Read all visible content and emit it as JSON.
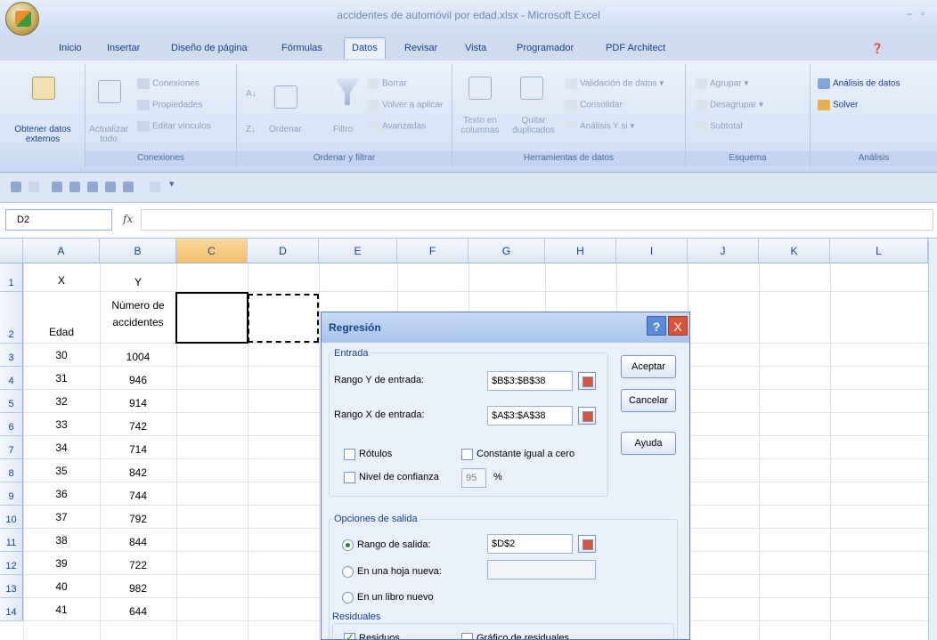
{
  "window": {
    "title": "accidentes de automóvil por edad.xlsx - Microsoft Excel"
  },
  "tabs": [
    "Inicio",
    "Insertar",
    "Diseño de página",
    "Fórmulas",
    "Datos",
    "Revisar",
    "Vista",
    "Programador",
    "PDF Architect"
  ],
  "ribbon": {
    "get_external": "Obtener datos externos",
    "refresh": "Actualizar todo",
    "connections": "Conexiones",
    "properties": "Propiedades",
    "edit_links": "Editar vínculos",
    "group_connections": "Conexiones",
    "sort": "Ordenar",
    "filter": "Filtro",
    "clear": "Borrar",
    "reapply": "Volver a aplicar",
    "advanced": "Avanzadas",
    "group_sort_filter": "Ordenar y filtrar",
    "text_to_columns": "Texto en columnas",
    "remove_duplicates": "Quitar duplicados",
    "data_validation": "Validación de datos",
    "consolidate": "Consolidar",
    "what_if": "Análisis Y si",
    "group_data_tools": "Herramientas de datos",
    "group": "Agrupar",
    "ungroup": "Desagrupar",
    "subtotal": "Subtotal",
    "group_outline": "Esquema",
    "data_analysis": "Análisis de datos",
    "solver": "Solver",
    "group_analysis": "Análisis"
  },
  "formula_bar": {
    "name_box": "D2",
    "fx": "fx",
    "value": ""
  },
  "columns": [
    "A",
    "B",
    "C",
    "D",
    "E",
    "F",
    "G",
    "H",
    "I",
    "J",
    "K",
    "L"
  ],
  "rows": [
    {
      "n": "1",
      "a": "X",
      "b": "Y"
    },
    {
      "n": "2",
      "a": "Edad",
      "b": "Número de accidentes"
    },
    {
      "n": "3",
      "a": "30",
      "b": "1004"
    },
    {
      "n": "4",
      "a": "31",
      "b": "946"
    },
    {
      "n": "5",
      "a": "32",
      "b": "914"
    },
    {
      "n": "6",
      "a": "33",
      "b": "742"
    },
    {
      "n": "7",
      "a": "34",
      "b": "714"
    },
    {
      "n": "8",
      "a": "35",
      "b": "842"
    },
    {
      "n": "9",
      "a": "36",
      "b": "744"
    },
    {
      "n": "10",
      "a": "37",
      "b": "792"
    },
    {
      "n": "11",
      "a": "38",
      "b": "844"
    },
    {
      "n": "12",
      "a": "39",
      "b": "722"
    },
    {
      "n": "13",
      "a": "40",
      "b": "982"
    },
    {
      "n": "14",
      "a": "41",
      "b": "644"
    }
  ],
  "dialog": {
    "title": "Regresión",
    "help": "?",
    "close": "X",
    "input_section": "Entrada",
    "y_range_label": "Rango Y de entrada:",
    "y_range_value": "$B$3:$B$38",
    "x_range_label": "Rango X de entrada:",
    "x_range_value": "$A$3:$A$38",
    "labels_chk": "Rótulos",
    "const_zero_chk": "Constante igual a cero",
    "confidence_chk": "Nivel de confianza",
    "confidence_value": "95",
    "percent": "%",
    "output_section": "Opciones de salida",
    "output_range_label": "Rango de salida:",
    "output_range_value": "$D$2",
    "new_sheet_label": "En una hoja nueva:",
    "new_book_label": "En un libro nuevo",
    "residuals_section": "Residuales",
    "residuals_chk": "Residuos",
    "residuals_plot_chk": "Gráfico de residuales",
    "ok": "Aceptar",
    "cancel": "Cancelar",
    "help_btn": "Ayuda"
  }
}
